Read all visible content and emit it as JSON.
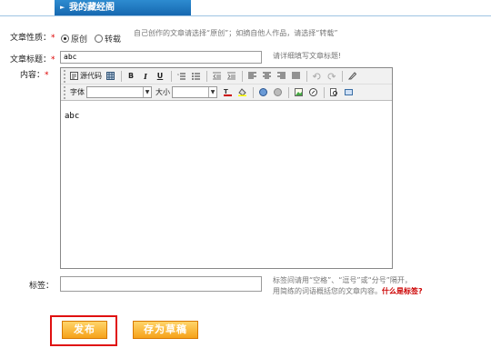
{
  "header": {
    "title": "我的藏经阁"
  },
  "form": {
    "type_label": "文章性质：",
    "type_options": [
      "原创",
      "转载"
    ],
    "type_hint": "自己创作的文章请选择“原创”；如摘自他人作品，请选择“转载”",
    "title_label": "文章标题：",
    "title_value": "abc",
    "title_hint": "请详细填写文章标题!",
    "content_label": "内容：",
    "required_mark": "*",
    "tags_label": "标签：",
    "tags_value": "",
    "tags_hint_line1": "标签间请用“空格”、“逗号”或“分号”隔开，",
    "tags_hint_line2": "用简练的词语概括您的文章内容。",
    "tags_help_link": "什么是标签?"
  },
  "editor": {
    "source_label": "源代码",
    "font_label": "字体",
    "size_label": "大小",
    "content_text": "abc",
    "buttons": [
      "B",
      "I",
      "U"
    ]
  },
  "actions": {
    "publish": "发布",
    "draft": "存为草稿"
  },
  "colors": {
    "tab": "#1f78c0",
    "button": "#f6a21a",
    "highlight": "#e01010",
    "required": "#dd0000"
  }
}
